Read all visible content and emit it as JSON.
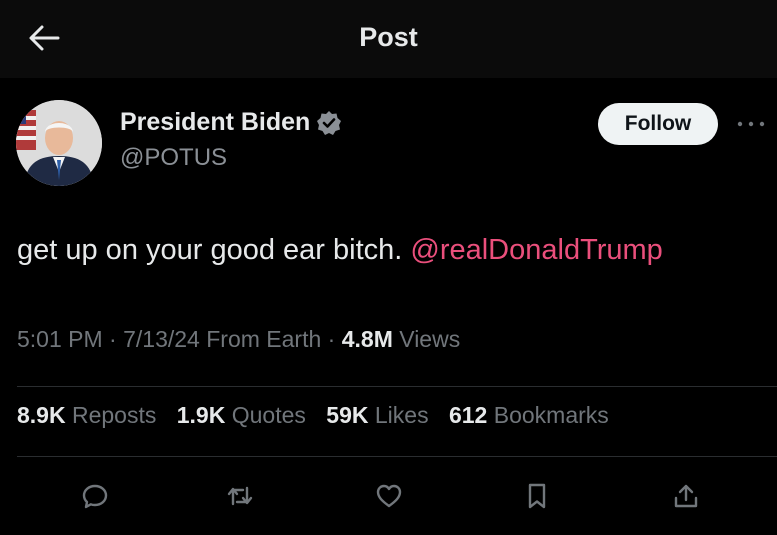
{
  "header": {
    "title": "Post",
    "back_icon": "arrow-left-icon"
  },
  "author": {
    "name": "President Biden",
    "handle": "@POTUS",
    "verified_icon": "verified-badge-icon",
    "verified_color": "#1d9bf0"
  },
  "follow_label": "Follow",
  "more_icon": "more-horizontal-icon",
  "tweet": {
    "text": "get up on your good ear bitch. ",
    "mention": "@realDonaldTrump",
    "mention_color": "#ea4f7c"
  },
  "meta": {
    "time": "5:01 PM",
    "separator": "·",
    "date": "7/13/24",
    "source": "From  Earth",
    "views_count": "4.8M",
    "views_label": "Views"
  },
  "stats": [
    {
      "count": "8.9K",
      "label": "Reposts"
    },
    {
      "count": "1.9K",
      "label": "Quotes"
    },
    {
      "count": "59K",
      "label": "Likes"
    },
    {
      "count": "612",
      "label": "Bookmarks"
    }
  ],
  "actions": [
    {
      "icon": "reply-icon"
    },
    {
      "icon": "repost-icon"
    },
    {
      "icon": "like-icon"
    },
    {
      "icon": "bookmark-icon"
    },
    {
      "icon": "share-icon"
    }
  ],
  "colors": {
    "background": "#000000",
    "header_background": "#0b0b0b",
    "text_primary": "#e7e9ea",
    "text_secondary": "#71767b",
    "follow_bg": "#eff3f4"
  }
}
